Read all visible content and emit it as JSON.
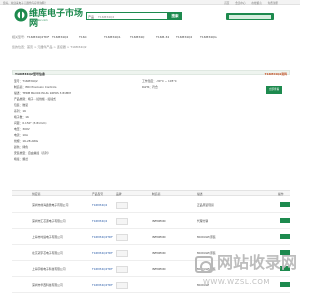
{
  "topbar": {
    "left": "您好，欢迎来电子元器件库存查询网！",
    "links": [
      "首页",
      "会员中心",
      "在线留言",
      "免费注册"
    ]
  },
  "header": {
    "logo_text": "维库电子市场网",
    "logo_sub": "www.dzsc.com",
    "search_category": "产品",
    "search_placeholder": "T16M34Q2",
    "search_button": "搜索"
  },
  "nav": [
    "相关型号:",
    "T16M34Q2TDF",
    "T16M34Q2",
    "T16C",
    "T16M34Q2.",
    "T16M34Q",
    "T16M-34",
    "T16M34Q2",
    "T16M34QG"
  ],
  "breadcrumb": "您的位置：首页 > 元器件产品 > 连接器 > T16M34Q2",
  "product": {
    "title": "T16M34Q2型号信息",
    "right_label": "T16M34Q2资料",
    "check_button": "立即查看"
  },
  "specs": [
    "型号：T16M34Q2",
    "制造商：IMO Precision Controls",
    "描述：TERM BLOCK PLUG 16POS 3.81MM",
    "产品类别：端子 - 接线板 - 接插式",
    "包装：散装",
    "系列：16",
    "端子数：16",
    "间距：0.150\" (3.81mm)",
    "电压：300V",
    "电流：10A",
    "线规：16-28 AWG",
    "颜色：绿色",
    "安装类型：自由悬挂（直列）",
    "端接：螺丝",
    "工作温度：-30°C ~ 105°C",
    "RoHS：符合"
  ],
  "table": {
    "headers": [
      "供应商",
      "产品型号",
      "品牌",
      "制造商",
      "描述",
      "操作"
    ],
    "rows": [
      {
        "supplier": "深圳市前海鑫微电子有限公司",
        "part": "T16M34Q2",
        "maker": "",
        "desc": "正品原装现货"
      },
      {
        "supplier": "深圳市汇芯源电子有限公司",
        "part": "T16M34Q2",
        "maker": "INFINEON",
        "desc": "代理分销"
      },
      {
        "supplier": "上海市时速电子有限公司",
        "part": "T16M34Q2TDF",
        "maker": "INFINEON",
        "desc": "MODULE/原装"
      },
      {
        "supplier": "北京冠宇芯电子有限公司",
        "part": "T16M34Q2TDF",
        "maker": "INFINEON",
        "desc": "MODULE/原装"
      },
      {
        "supplier": "上海宇格电子科技有限公司",
        "part": "T16M34Q2TDF",
        "maker": "INFINEON",
        "desc": "MODULE/原装"
      },
      {
        "supplier": "深圳市华西科技有限公司",
        "part": "T16M34Q2TDF",
        "maker": "",
        "desc": "MODULE"
      }
    ]
  },
  "watermark": {
    "main": "网站收录网",
    "url": "WWW.WZSL.COM"
  },
  "colors": {
    "brand": "#1d8a4e",
    "link": "#2a5ca8",
    "accent": "#c34b1e"
  }
}
